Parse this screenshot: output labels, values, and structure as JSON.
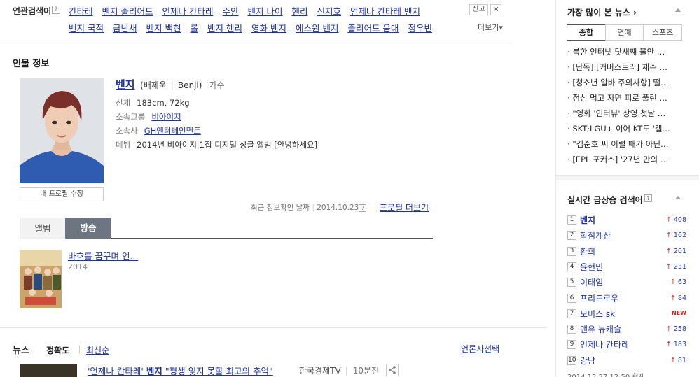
{
  "related": {
    "label": "연관검색어",
    "help": "?",
    "row1": [
      "칸타레",
      "벤지 줄리어드",
      "언제나 칸타레",
      "주안",
      "벤지 나이",
      "헨리",
      "신지호",
      "언제나 칸타레 벤지"
    ],
    "row2": [
      "벤지 국적",
      "금난새",
      "벤지 백현",
      "롤",
      "벤지 헨리",
      "영화 벤지",
      "에스원 벤지",
      "줄리어드 음대",
      "정우빈"
    ],
    "report": "신고",
    "close": "✕",
    "more": "더보기▾"
  },
  "profile": {
    "heading": "인물 정보",
    "name": "벤지",
    "alias_korean": "배제욱",
    "alias_english": "Benji",
    "job": "가수",
    "edit_button": "내 프로필 수정",
    "info": [
      {
        "key": "신체",
        "value": "183cm, 72kg",
        "link": false
      },
      {
        "key": "소속그룹",
        "value": "비아이지",
        "link": true
      },
      {
        "key": "소속사",
        "value": "GH엔터테인먼트",
        "link": true
      },
      {
        "key": "데뷔",
        "value": "2014년 비아이지 1집 디지털 싱글 앨범 [안녕하세요]",
        "link": false
      }
    ],
    "checked": "최근 정보확인 날짜",
    "checked_date": "2014.10.23",
    "more": "프로필 더보기"
  },
  "tabs": [
    "앨범",
    "방송"
  ],
  "broadcast": {
    "title": "바흐를 꿈꾸며 언...",
    "year": "2014"
  },
  "news": {
    "heading": "뉴스",
    "sort_accuracy": "정확도",
    "sort_latest": "최신순",
    "press_select": "언론사선택",
    "headline_pre": "'언제나 칸타레'",
    "headline_bold": "벤지",
    "headline_post": "\"평생 잊지 못할 최고의 추억\"",
    "source": "한국경제TV",
    "time": "10분전"
  },
  "sidebar": {
    "most_viewed_title": "가장 많이 본 뉴스 ›",
    "news_tabs": [
      "종합",
      "연예",
      "스포츠"
    ],
    "news_items": [
      "북한 인터넷 닷새째 불안 …",
      "[단독] [커버스토리] 제주 …",
      "[청소년 알바 주의사항] 떨…",
      "점심 먹고 자면 피로 풀린 …",
      "\"영화 '인터뷰' 상영 첫날 …",
      "SKT·LGU+ 이어 KT도 '갤…",
      "\"김준호 씨 이럴 때가 아닌…",
      "[EPL 포커스] '27년 만의 …"
    ],
    "rising_title": "실시간 급상승 검색어",
    "rising_help": "?",
    "rising": [
      {
        "rank": "1",
        "keyword": "벤지",
        "change": "408",
        "new": false
      },
      {
        "rank": "2",
        "keyword": "학점계산",
        "change": "162",
        "new": false
      },
      {
        "rank": "3",
        "keyword": "환희",
        "change": "201",
        "new": false
      },
      {
        "rank": "4",
        "keyword": "윤현민",
        "change": "231",
        "new": false
      },
      {
        "rank": "5",
        "keyword": "이태임",
        "change": "63",
        "new": false
      },
      {
        "rank": "6",
        "keyword": "프리드로우",
        "change": "84",
        "new": false
      },
      {
        "rank": "7",
        "keyword": "모비스 sk",
        "change": "NEW",
        "new": true
      },
      {
        "rank": "8",
        "keyword": "맨유 뉴캐슬",
        "change": "258",
        "new": false
      },
      {
        "rank": "9",
        "keyword": "언제나 칸타레",
        "change": "183",
        "new": false
      },
      {
        "rank": "10",
        "keyword": "강남",
        "change": "81",
        "new": false
      }
    ],
    "timestamp": "2014.12.27 12:50 현재"
  }
}
